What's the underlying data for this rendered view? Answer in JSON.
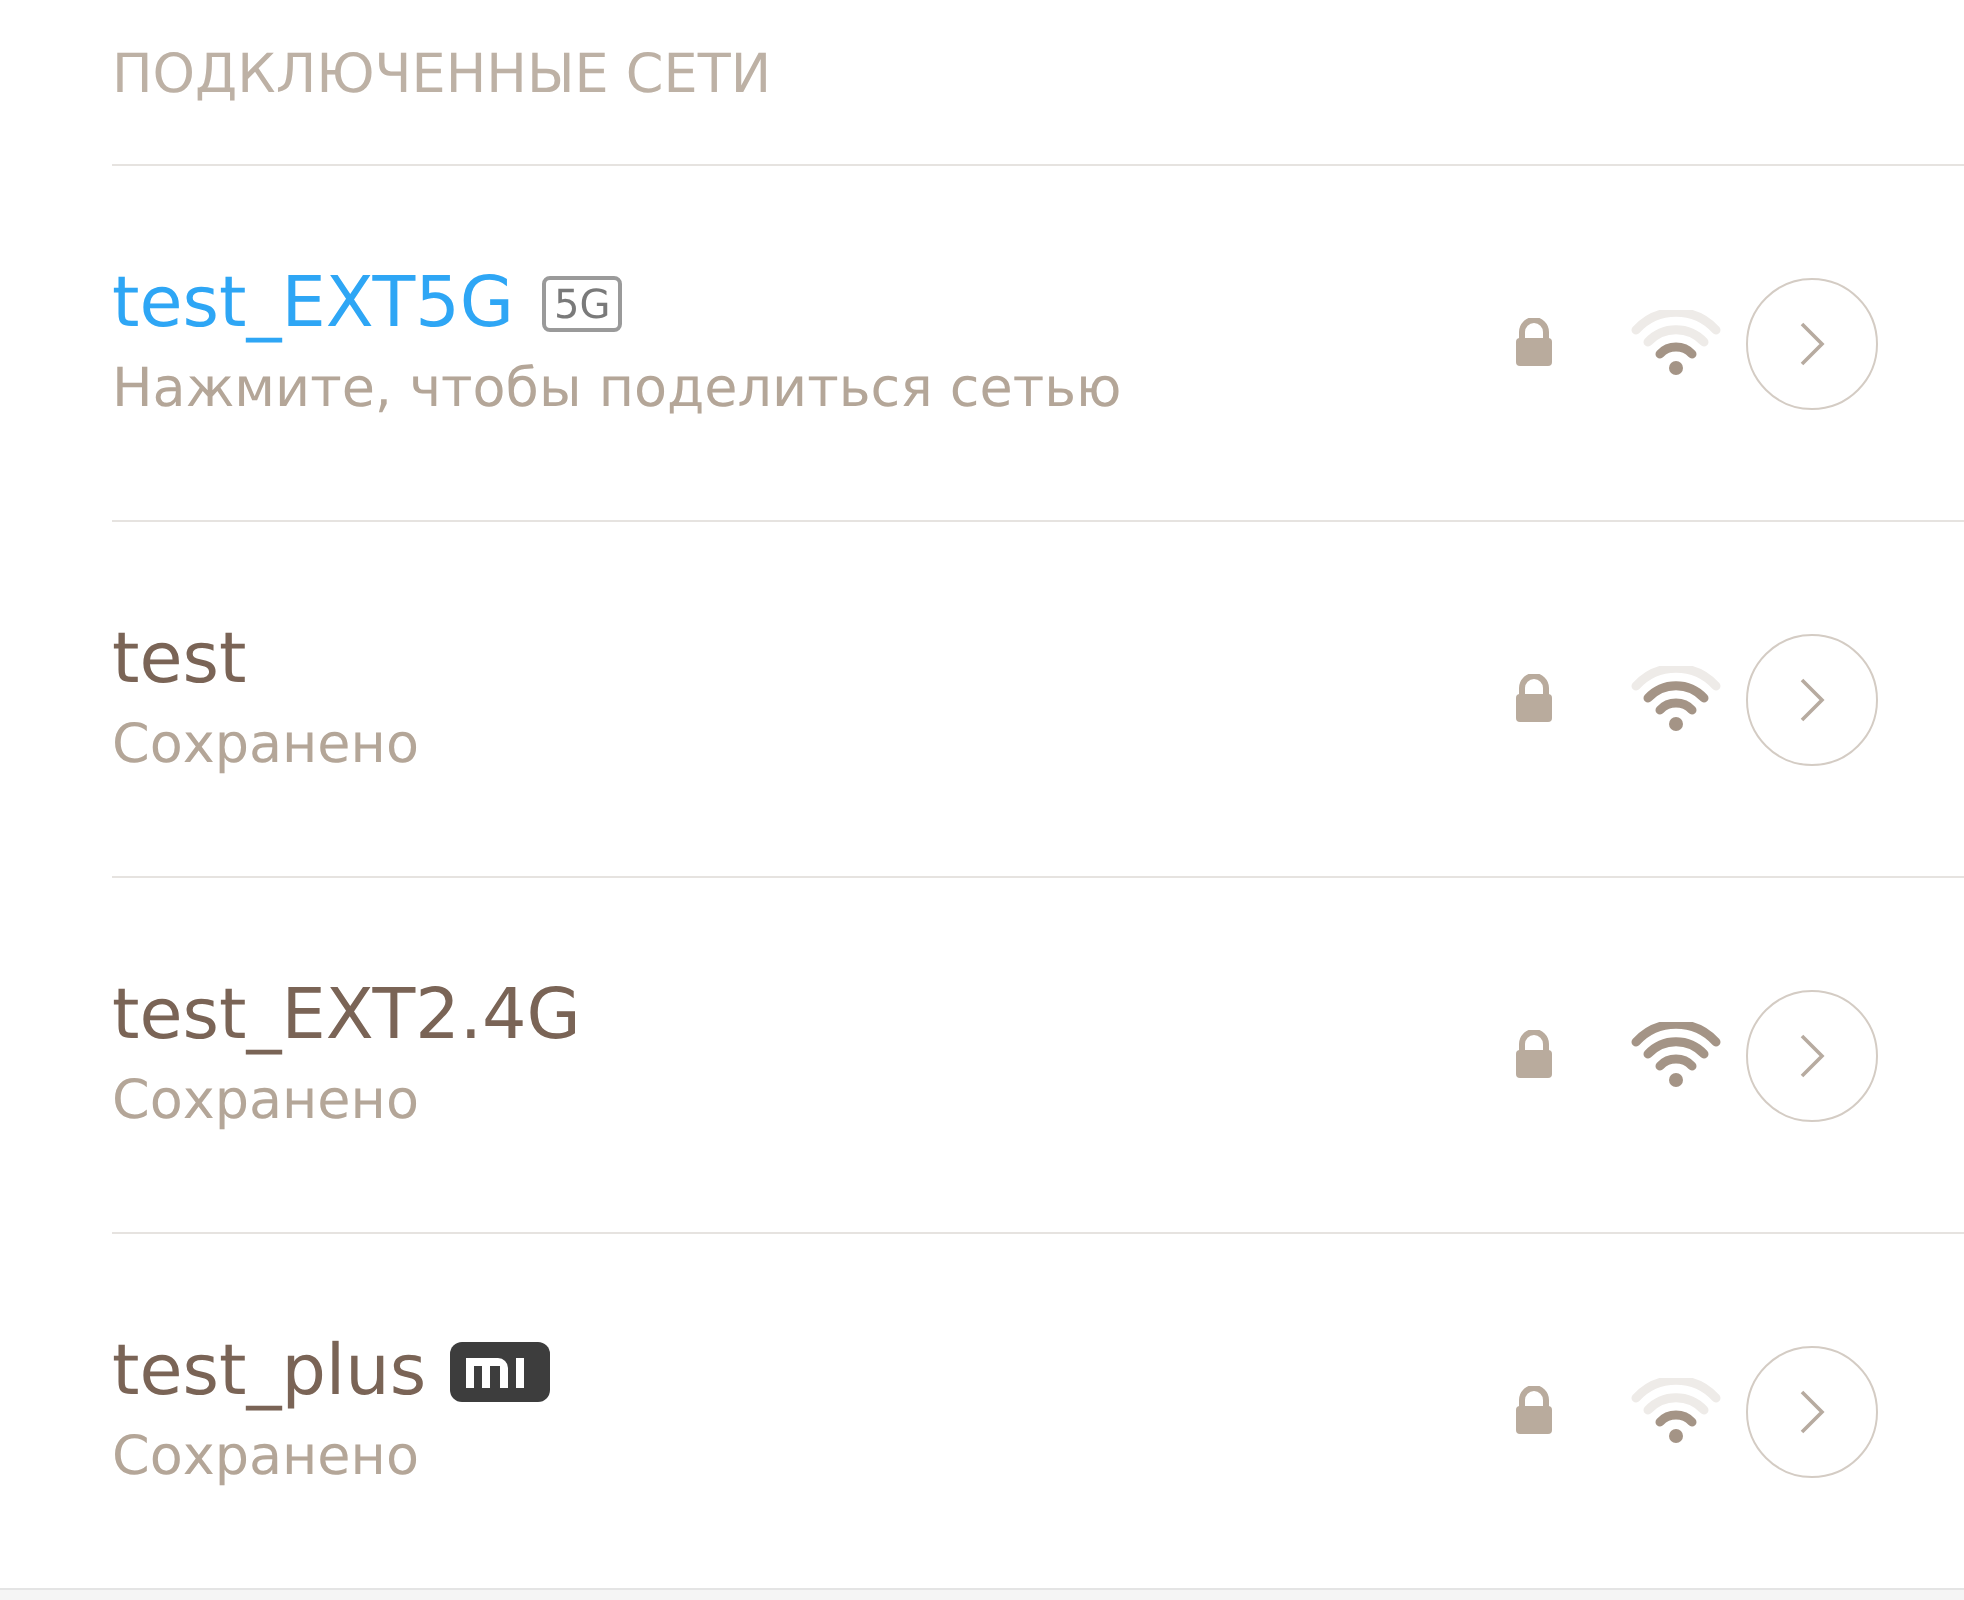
{
  "section_title": "ПОДКЛЮЧЕННЫЕ СЕТИ",
  "networks": [
    {
      "name": "test_EXT5G",
      "connected": true,
      "badge": {
        "kind": "text",
        "label": "5G"
      },
      "status": "Нажмите, чтобы поделиться сетью",
      "secured": true,
      "kind": "weak"
    },
    {
      "name": "test",
      "connected": false,
      "status": "Сохранено",
      "secured": true,
      "kind": "fair"
    },
    {
      "name": "test_EXT2.4G",
      "connected": false,
      "status": "Сохранено",
      "secured": true,
      "kind": "strong"
    },
    {
      "name": "test_plus",
      "connected": false,
      "badge": {
        "kind": "logo"
      },
      "status": "Сохранено",
      "secured": true,
      "kind": "weak"
    }
  ]
}
